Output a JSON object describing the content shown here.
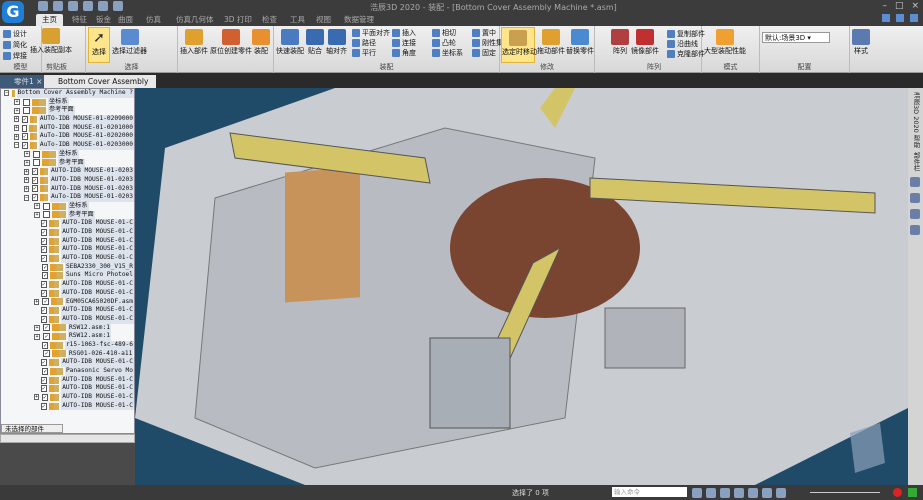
{
  "app": {
    "logo": "G",
    "window_title": "浩辰3D 2020 - 装配 - [Bottom Cover Assembly Machine *.asm]"
  },
  "ribbon_tabs": [
    "主页",
    "特征",
    "钣金",
    "曲面",
    "仿真",
    "仿真几何体",
    "3D 打印",
    "检查",
    "工具",
    "视图",
    "数据管理"
  ],
  "ribbon": {
    "model": {
      "label": "模型",
      "items": [
        "设计",
        "简化",
        "焊接"
      ]
    },
    "clipboard": {
      "label": "剪贴板",
      "button": "插入装配副本"
    },
    "select": {
      "label": "选择",
      "buttons": [
        "选择",
        "选择过滤器"
      ]
    },
    "parts": {
      "buttons": [
        "插入部件",
        "原位创建零件",
        "装配"
      ]
    },
    "assemble": {
      "label": "装配",
      "buttons": [
        "快速装配",
        "贴合",
        "轴对齐"
      ],
      "small": [
        "平面对齐",
        "路径",
        "平行",
        "插入",
        "连接",
        "角度",
        "相切",
        "凸轮",
        "坐标系",
        "置中",
        "刚性集",
        "固定"
      ]
    },
    "modify": {
      "label": "修改",
      "buttons": [
        "选定时移动",
        "拖动部件",
        "替换零件"
      ]
    },
    "pattern": {
      "label": "阵列",
      "buttons": [
        "阵列",
        "镜像部件"
      ],
      "small": [
        "复制部件",
        "沿曲线",
        "克隆部件"
      ]
    },
    "mode": {
      "label": "模式",
      "button": "大型装配性能"
    },
    "config": {
      "label": "配置",
      "combo": "默认:场景3D"
    },
    "style": {
      "button": "样式"
    }
  },
  "doc_tabs": [
    "零件1",
    "Bottom Cover Assembly Ma..."
  ],
  "tree": {
    "rows": [
      {
        "d": 0,
        "t": "Bottom Cover Assembly Machine ?",
        "c": null,
        "e": "-"
      },
      {
        "d": 1,
        "t": "坐标系",
        "c": false,
        "e": "+"
      },
      {
        "d": 1,
        "t": "参考平面",
        "c": false,
        "e": "+"
      },
      {
        "d": 1,
        "t": "AUTO-IDB MOUSE-01-0209000",
        "c": true,
        "e": "+"
      },
      {
        "d": 1,
        "t": "AUTO-IDB MOUSE-01-0201000",
        "c": false,
        "e": "+"
      },
      {
        "d": 1,
        "t": "AuTo-IDB MOUSE-01-0202000",
        "c": true,
        "e": "+"
      },
      {
        "d": 1,
        "t": "AuTo-IDB MOUSE-01-0203000",
        "c": true,
        "e": "-"
      },
      {
        "d": 2,
        "t": "坐标系",
        "c": false,
        "e": "+"
      },
      {
        "d": 2,
        "t": "参考平面",
        "c": false,
        "e": "+"
      },
      {
        "d": 2,
        "t": "AUTO-IDB MOUSE-01-0203",
        "c": true,
        "e": "+"
      },
      {
        "d": 2,
        "t": "AUTO-IDB MOUSE-01-0203",
        "c": true,
        "e": "+"
      },
      {
        "d": 2,
        "t": "AUTO-IDB MOUSE-01-0203",
        "c": true,
        "e": "+"
      },
      {
        "d": 2,
        "t": "AuTo-IDB MOUSE-01-0203",
        "c": true,
        "e": "-"
      },
      {
        "d": 3,
        "t": "坐标系",
        "c": false,
        "e": "+"
      },
      {
        "d": 3,
        "t": "参考平面",
        "c": false,
        "e": "+"
      },
      {
        "d": 3,
        "t": "AUTO-IDB MOUSE-01-C",
        "c": true,
        "e": ""
      },
      {
        "d": 3,
        "t": "AUTO-IDB MOUSE-01-C",
        "c": true,
        "e": ""
      },
      {
        "d": 3,
        "t": "AUTO-IDB MOUSE-01-C",
        "c": true,
        "e": ""
      },
      {
        "d": 3,
        "t": "AUTO-IDB MOUSE-01-C",
        "c": true,
        "e": ""
      },
      {
        "d": 3,
        "t": "AUTO-IDB MOUSE-01-C",
        "c": true,
        "e": ""
      },
      {
        "d": 3,
        "t": "SEBA2330_300_V15_R",
        "c": true,
        "e": ""
      },
      {
        "d": 3,
        "t": "Suns Micro Photoel",
        "c": true,
        "e": ""
      },
      {
        "d": 3,
        "t": "AUTO-IDB MOUSE-01-C",
        "c": true,
        "e": ""
      },
      {
        "d": 3,
        "t": "AUTO-IDB MOUSE-01-C",
        "c": true,
        "e": ""
      },
      {
        "d": 3,
        "t": "EGM05CA65020DF.asm",
        "c": true,
        "e": "+"
      },
      {
        "d": 3,
        "t": "AUTO-IDB MOUSE-01-C",
        "c": true,
        "e": ""
      },
      {
        "d": 3,
        "t": "AUTO-IDB MOUSE-01-C",
        "c": true,
        "e": ""
      },
      {
        "d": 3,
        "t": "RSW12.asm:1",
        "c": true,
        "e": "+"
      },
      {
        "d": 3,
        "t": "RSW12.asm:1",
        "c": true,
        "e": "+"
      },
      {
        "d": 3,
        "t": "r15-1063-fsc-489-6",
        "c": true,
        "e": ""
      },
      {
        "d": 3,
        "t": "RSG01-026-410-a11",
        "c": true,
        "e": ""
      },
      {
        "d": 3,
        "t": "AUTO-IDB MOUSE-01-C",
        "c": true,
        "e": ""
      },
      {
        "d": 3,
        "t": "Panasonic Servo Mo",
        "c": true,
        "e": ""
      },
      {
        "d": 3,
        "t": "AUTO-IDB MOUSE-01-C",
        "c": true,
        "e": ""
      },
      {
        "d": 3,
        "t": "AUTO-IDB MOUSE-01-C",
        "c": true,
        "e": ""
      },
      {
        "d": 3,
        "t": "AUTO-IDB MOUSE-01-C",
        "c": true,
        "e": "+"
      },
      {
        "d": 3,
        "t": "AUTO-IDB MOUSE-01-C",
        "c": true,
        "e": ""
      }
    ],
    "filter_button": "未选择的部件"
  },
  "right_panel": {
    "tabs": [
      "浩辰3D 2020 帮助",
      "部件栏"
    ]
  },
  "status": {
    "selection": "选择了 0 项",
    "command_placeholder": "输入命令"
  },
  "colors": {
    "viewport_bg": "#1f4a68",
    "highlight": "#fce58a",
    "accent": "#1f7fd6"
  }
}
